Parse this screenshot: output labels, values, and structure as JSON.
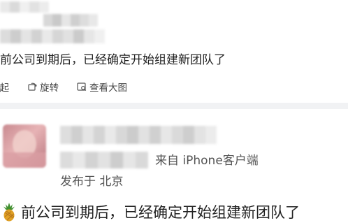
{
  "post": {
    "text": "赛前公司到期后，已经确定开始组建新团队了",
    "actions": {
      "collapse_label": "收起",
      "rotate_label": "旋转",
      "view_large_label": "查看大图"
    }
  },
  "comment": {
    "source": "来自 iPhone客户端",
    "location": "发布于 北京",
    "text": "前公司到期后，已经确定开始组建新团队了",
    "emoji_icon": "pineapple-icon"
  },
  "colors": {
    "divider": "#f1f2f4",
    "text": "#222222",
    "meta_text": "#555555"
  }
}
